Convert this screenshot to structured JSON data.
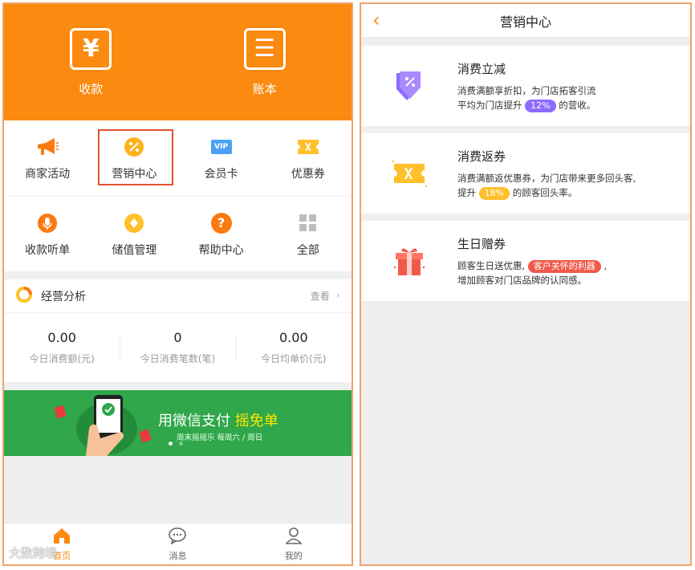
{
  "left": {
    "hero": [
      {
        "icon": "yen-icon",
        "glyph": "¥",
        "label": "收款"
      },
      {
        "icon": "ledger-icon",
        "glyph": "☰",
        "label": "账本"
      }
    ],
    "grid_row1": [
      {
        "icon": "megaphone-icon",
        "label": "商家活动"
      },
      {
        "icon": "percent-badge-icon",
        "label": "营销中心"
      },
      {
        "icon": "vip-icon",
        "glyph": "VIP",
        "label": "会员卡"
      },
      {
        "icon": "coupon-icon",
        "label": "优惠券"
      }
    ],
    "grid_row2": [
      {
        "icon": "microphone-icon",
        "label": "收款听单"
      },
      {
        "icon": "diamond-icon",
        "label": "储值管理"
      },
      {
        "icon": "question-icon",
        "glyph": "?",
        "label": "帮助中心"
      },
      {
        "icon": "grid-icon",
        "label": "全部"
      }
    ],
    "analysis": {
      "title": "经营分析",
      "more": "查看",
      "stats": [
        {
          "value": "0.00",
          "label": "今日消费额(元)"
        },
        {
          "value": "0",
          "label": "今日消费笔数(笔)"
        },
        {
          "value": "0.00",
          "label": "今日均单价(元)"
        }
      ]
    },
    "banner": {
      "title": "用微信支付",
      "highlight": "摇免单",
      "subtitle": "周末摇摇乐 每周六 / 周日"
    },
    "tabs": [
      {
        "icon": "home-icon",
        "label": "首页"
      },
      {
        "icon": "chat-icon",
        "label": "消息"
      },
      {
        "icon": "person-icon",
        "label": "我的"
      }
    ],
    "watermark": "大数跨境"
  },
  "right": {
    "title": "营销中心",
    "cards": [
      {
        "icon": "discount-tag-icon",
        "title": "消费立减",
        "line1": "消费满额享折扣，为门店拓客引流",
        "line2_pre": "平均为门店提升",
        "pill": "12%",
        "line2_post": "的营收。"
      },
      {
        "icon": "ticket-icon",
        "title": "消费返券",
        "line1": "消费满额返优惠券，为门店带来更多回头客,",
        "line2_pre": "提升",
        "pill": "18%",
        "line2_post": "的顾客回头率。"
      },
      {
        "icon": "gift-icon",
        "title": "生日赠券",
        "line1_pre": "顾客生日送优惠,",
        "pill": "客户关怀的利器",
        "line1_post": ",",
        "line2": "增加顾客对门店品牌的认同感。"
      }
    ]
  },
  "colors": {
    "brand_orange": "#fb8a10",
    "banner_green": "#2fa74a",
    "purple": "#8e6bff",
    "yellow": "#ffc02a",
    "red": "#f05a4c"
  }
}
